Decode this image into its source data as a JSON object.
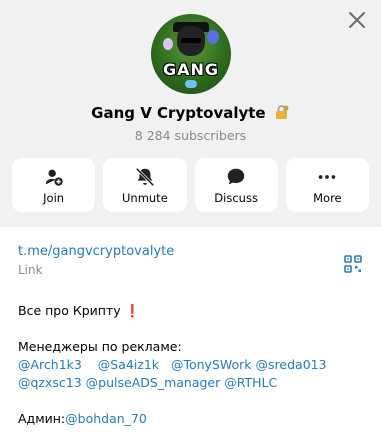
{
  "channel": {
    "title": "Gang V Cryptovalyte",
    "lock_emoji": "🔐",
    "subscribers": "8 284 subscribers",
    "avatar_text": "GANG"
  },
  "actions": [
    {
      "label": "Join",
      "icon": "add-user-icon"
    },
    {
      "label": "Unmute",
      "icon": "bell-muted-icon"
    },
    {
      "label": "Discuss",
      "icon": "chat-bubble-icon"
    },
    {
      "label": "More",
      "icon": "more-dots-icon"
    }
  ],
  "info": {
    "link": "t.me/gangvcryptovalyte",
    "link_caption": "Link",
    "qr_icon": "qr-code-icon"
  },
  "description": {
    "line1_text": "Все про Крипту",
    "line1_emoji": "❗",
    "managers_label": "Менеджеры по рекламе:",
    "managers_row1": [
      "@Arch1k3",
      "@Sa4iz1k",
      "@TonySWork",
      "@sreda013"
    ],
    "managers_row2": [
      "@qzxsc13",
      "@pulseADS_manager",
      "@RTHLC"
    ],
    "admin_label": "Админ:",
    "admin_handle": "@bohdan_70"
  },
  "colors": {
    "header_bg": "#f1f1f1",
    "link": "#2a7ab8",
    "muted": "#8a8a8a"
  }
}
